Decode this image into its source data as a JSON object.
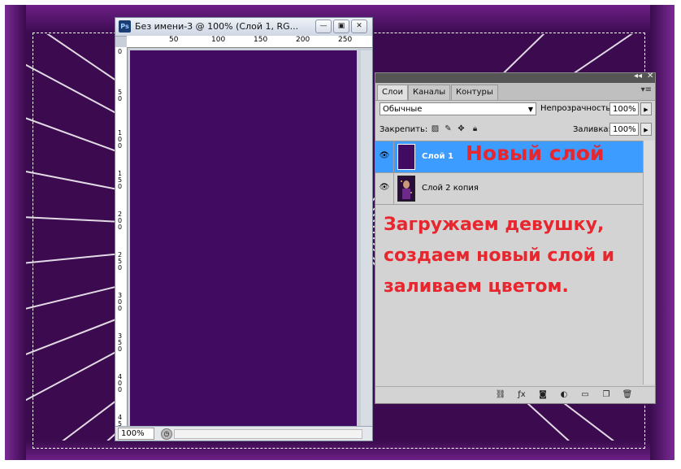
{
  "document": {
    "title": "Без имени-3 @ 100% (Слой 1, RG...",
    "ps_logo": "Ps",
    "zoom": "100%",
    "ruler_top_ticks": [
      "50",
      "100",
      "150",
      "200",
      "250"
    ],
    "ruler_left_ticks": [
      "0",
      "5 0",
      "1 0 0",
      "1 5 0",
      "2 0 0",
      "2 5 0",
      "3 0 0",
      "3 5 0",
      "4 0 0",
      "4 5"
    ],
    "canvas_color": "#420b62",
    "minimize": "—",
    "restore": "▣",
    "close": "✕"
  },
  "panel": {
    "collapse": "◂◂",
    "close": "✕",
    "tabs": [
      {
        "label": "Слои"
      },
      {
        "label": "Каналы"
      },
      {
        "label": "Контуры"
      }
    ],
    "menu_icon": "▾≡",
    "blend_mode": "Обычные",
    "opacity_label": "Непрозрачность:",
    "opacity_value": "100%",
    "lock_label": "Закрепить:",
    "fill_label": "Заливка:",
    "fill_value": "100%",
    "layers": [
      {
        "name": "Слой 1",
        "selected": true,
        "thumb_color": "#420b62"
      },
      {
        "name": "Слой 2 копия",
        "selected": false,
        "thumb_color": "#2a0d3b"
      }
    ]
  },
  "annotations": {
    "new_layer": "Новый слой",
    "instructions": "Загружаем девушку, создаем новый слой и заливаем цветом."
  }
}
